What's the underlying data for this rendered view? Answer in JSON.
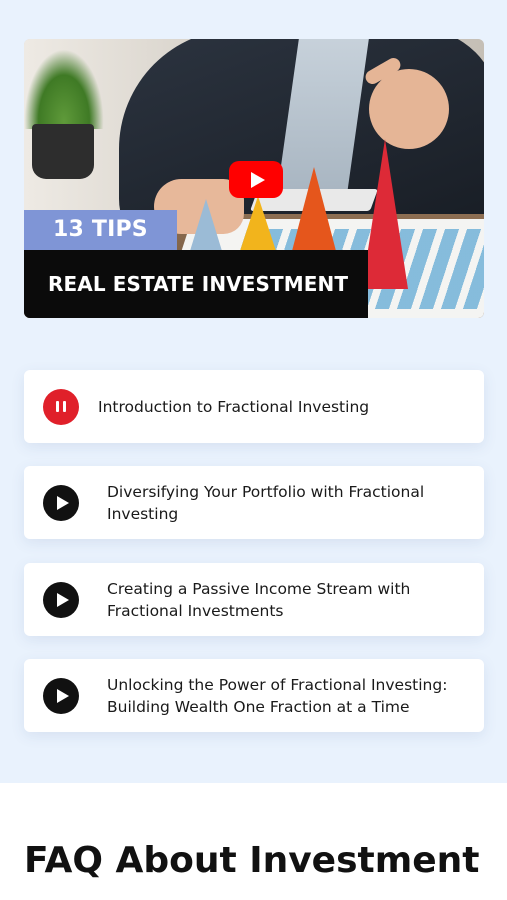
{
  "video": {
    "tips_label": "13 TIPS",
    "topic_label": "REAL ESTATE INVESTMENT",
    "play_icon": "youtube-play-icon",
    "brand_color": "#ff0000"
  },
  "playlist": {
    "items": [
      {
        "title": "Introduction to Fractional Investing",
        "state": "playing",
        "icon": "pause-icon"
      },
      {
        "title": "Diversifying Your Portfolio with Fractional Investing",
        "state": "idle",
        "icon": "play-icon"
      },
      {
        "title": "Creating a Passive Income Stream with Fractional Investments",
        "state": "idle",
        "icon": "play-icon"
      },
      {
        "title": "Unlocking the Power of Fractional Investing: Building Wealth One Fraction at a Time",
        "state": "idle",
        "icon": "play-icon"
      }
    ]
  },
  "faq": {
    "title": "FAQ About Investment"
  },
  "colors": {
    "section_bg": "#e9f2fd",
    "pause_accent": "#e0202a",
    "play_accent": "#111111"
  }
}
